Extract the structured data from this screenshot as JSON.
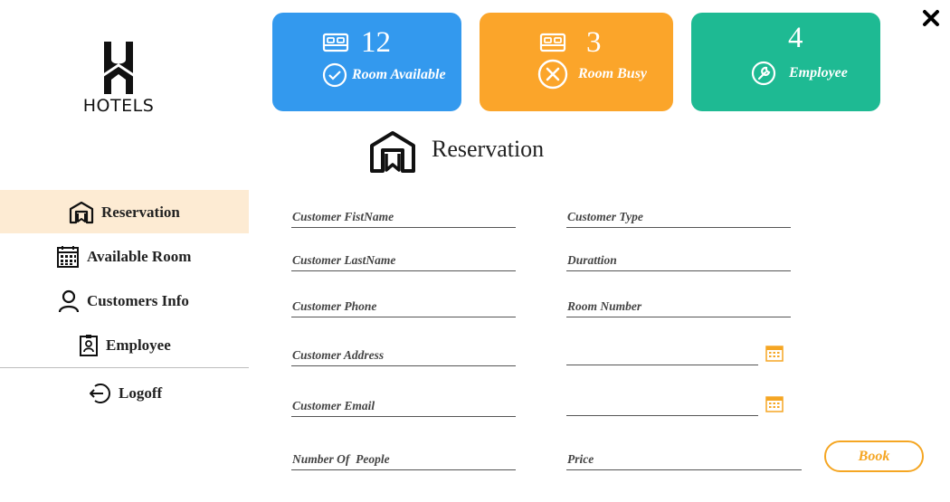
{
  "brand": {
    "logo_text": "HOTELS"
  },
  "stats": [
    {
      "value": "12",
      "label": "Room Available",
      "color": "#3399ee",
      "icon": "bed-icon",
      "badge_icon": "check-circle-icon"
    },
    {
      "value": "3",
      "label": "Room Busy",
      "color": "#fba52a",
      "icon": "bed-icon",
      "badge_icon": "x-circle-icon"
    },
    {
      "value": "4",
      "label": "Employee",
      "color": "#1eba93",
      "icon": "wrench-icon"
    }
  ],
  "section": {
    "title": "Reservation"
  },
  "sidebar": {
    "items": [
      {
        "label": "Reservation",
        "icon": "reservation-icon",
        "active": true
      },
      {
        "label": "Available Room",
        "icon": "calendar-grid-icon"
      },
      {
        "label": "Customers Info",
        "icon": "user-icon"
      },
      {
        "label": "Employee",
        "icon": "badge-icon"
      },
      {
        "label": "Logoff",
        "icon": "logout-icon"
      }
    ]
  },
  "form": {
    "left": [
      {
        "placeholder": "Customer FistName"
      },
      {
        "placeholder": "Customer LastName"
      },
      {
        "placeholder": "Customer Phone"
      },
      {
        "placeholder": "Customer Address"
      },
      {
        "placeholder": "Customer Email"
      },
      {
        "placeholder": "Number Of  People"
      }
    ],
    "right": [
      {
        "placeholder": "Customer Type"
      },
      {
        "placeholder": "Durattion"
      },
      {
        "placeholder": "Room Number"
      },
      {
        "placeholder": ""
      },
      {
        "placeholder": ""
      },
      {
        "placeholder": "Price"
      }
    ],
    "book_label": "Book"
  },
  "colors": {
    "accent": "#f5a623",
    "active_nav_bg": "#fdebd3"
  }
}
